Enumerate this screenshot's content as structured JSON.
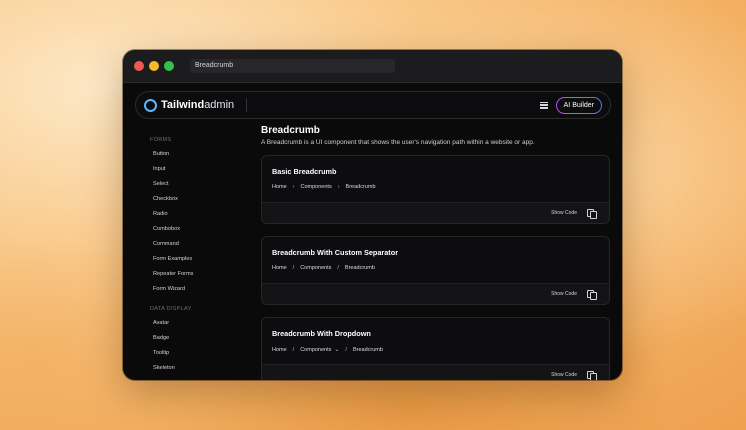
{
  "window": {
    "address_text": "Breadcrumb"
  },
  "appbar": {
    "brand_bold": "Tailwind",
    "brand_light": "admin",
    "ai_button": "AI Builder"
  },
  "sidebar": {
    "sections": [
      {
        "title": "FORMS",
        "items": [
          "Button",
          "Input",
          "Select",
          "Checkbox",
          "Radio",
          "Combobox",
          "Command",
          "Form Examples",
          "Repeater Forms",
          "Form Wizard"
        ]
      },
      {
        "title": "DATA DISPLAY",
        "items": [
          "Avatar",
          "Badge",
          "Tooltip",
          "Skeleton"
        ]
      }
    ]
  },
  "main": {
    "title": "Breadcrumb",
    "description": "A Breadcrumb is a UI component that shows the user's navigation path within a website or app.",
    "cards": [
      {
        "title": "Basic Breadcrumb",
        "separator": "›",
        "crumbs": [
          "Home",
          "Components",
          "Breadcrumb"
        ],
        "dropdown_index": -1,
        "show_code": "Show Code"
      },
      {
        "title": "Breadcrumb With Custom Separator",
        "separator": "/",
        "crumbs": [
          "Home",
          "Components",
          "Breadcrumb"
        ],
        "dropdown_index": -1,
        "show_code": "Show Code"
      },
      {
        "title": "Breadcrumb With Dropdown",
        "separator": "/",
        "crumbs": [
          "Home",
          "Components",
          "Breadcrumb"
        ],
        "dropdown_index": 1,
        "show_code": "Show Code"
      }
    ]
  },
  "colors": {
    "accent_ring": "#5ab7ff",
    "window_bg": "#0a0a0b"
  }
}
